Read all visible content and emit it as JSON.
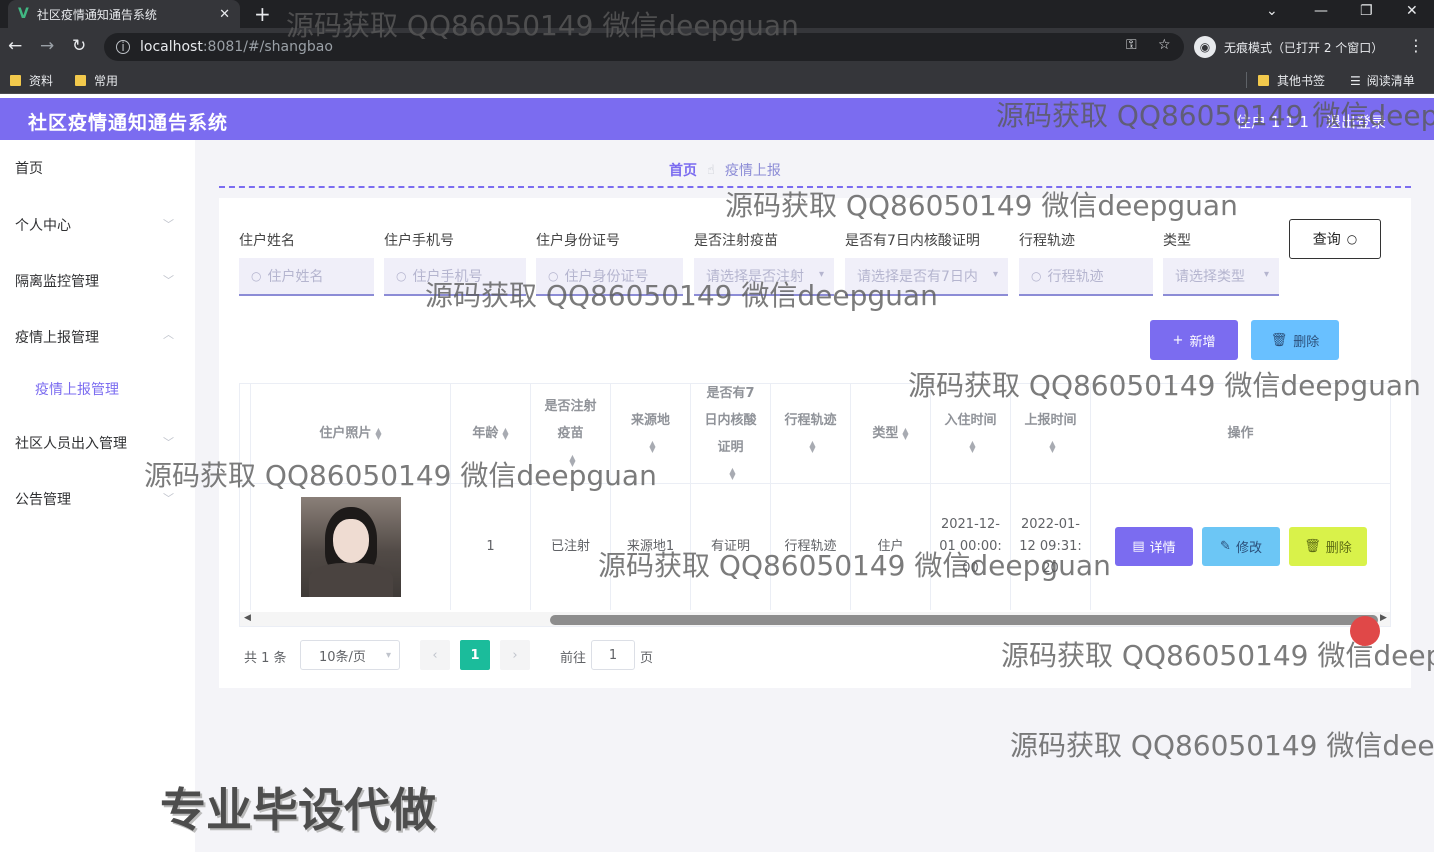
{
  "browser": {
    "tab_title": "社区疫情通知通告系统",
    "tab_logo": "V",
    "url_host": "localhost",
    "url_rest": ":8081/#/shangbao",
    "incognito_label": "无痕模式（已打开 2 个窗口）",
    "bookmarks": [
      "资料",
      "常用"
    ],
    "bookmarks_right": [
      "其他书签",
      "阅读清单"
    ]
  },
  "header": {
    "title": "社区疫情通知通告系统",
    "user": "住户 1 1 1",
    "logout": "退出登录"
  },
  "sidebar": {
    "items": [
      {
        "label": "首页"
      },
      {
        "label": "个人中心"
      },
      {
        "label": "隔离监控管理"
      },
      {
        "label": "疫情上报管理"
      },
      {
        "label": "疫情上报管理"
      },
      {
        "label": "社区人员出入管理"
      },
      {
        "label": "公告管理"
      }
    ]
  },
  "breadcrumb": {
    "home": "首页",
    "current": "疫情上报"
  },
  "filters": [
    {
      "label": "住户姓名",
      "placeholder": "住户姓名"
    },
    {
      "label": "住户手机号",
      "placeholder": "住户手机号"
    },
    {
      "label": "住户身份证号",
      "placeholder": "住户身份证号"
    },
    {
      "label": "是否注射疫苗",
      "placeholder": "请选择是否注射"
    },
    {
      "label": "是否有7日内核酸证明",
      "placeholder": "请选择是否有7日内"
    },
    {
      "label": "行程轨迹",
      "placeholder": "行程轨迹"
    },
    {
      "label": "类型",
      "placeholder": "请选择类型"
    }
  ],
  "buttons": {
    "query": "查询",
    "add": "新增",
    "delete": "删除"
  },
  "table": {
    "headers": [
      "住户照片",
      "年龄",
      "是否注射疫苗",
      "来源地",
      "是否有7日内核酸证明",
      "行程轨迹",
      "类型",
      "入住时间",
      "上报时间",
      "操作"
    ],
    "rows": [
      {
        "age": "1",
        "vaccine": "已注射",
        "origin": "来源地1",
        "proof": "有证明",
        "track": "行程轨迹",
        "type": "住户",
        "checkin": "2021-12-01 00:00:00",
        "report": "2022-01-12 09:31:20",
        "ops": [
          "详情",
          "修改",
          "删除"
        ]
      }
    ]
  },
  "pagination": {
    "total": "共 1 条",
    "page_size": "10条/页",
    "current": "1",
    "goto_label": "前往",
    "goto_value": "1",
    "unit": "页"
  },
  "watermarks": [
    "源码获取 QQ86050149 微信deepguan",
    "专业毕设代做"
  ],
  "colors": {
    "accent": "#7b6cf0",
    "page_active": "#1bbc9b",
    "delete_btn": "#69c0ff",
    "edit_btn": "#6cc6f5",
    "row_delete_btn": "#d9f24a"
  }
}
